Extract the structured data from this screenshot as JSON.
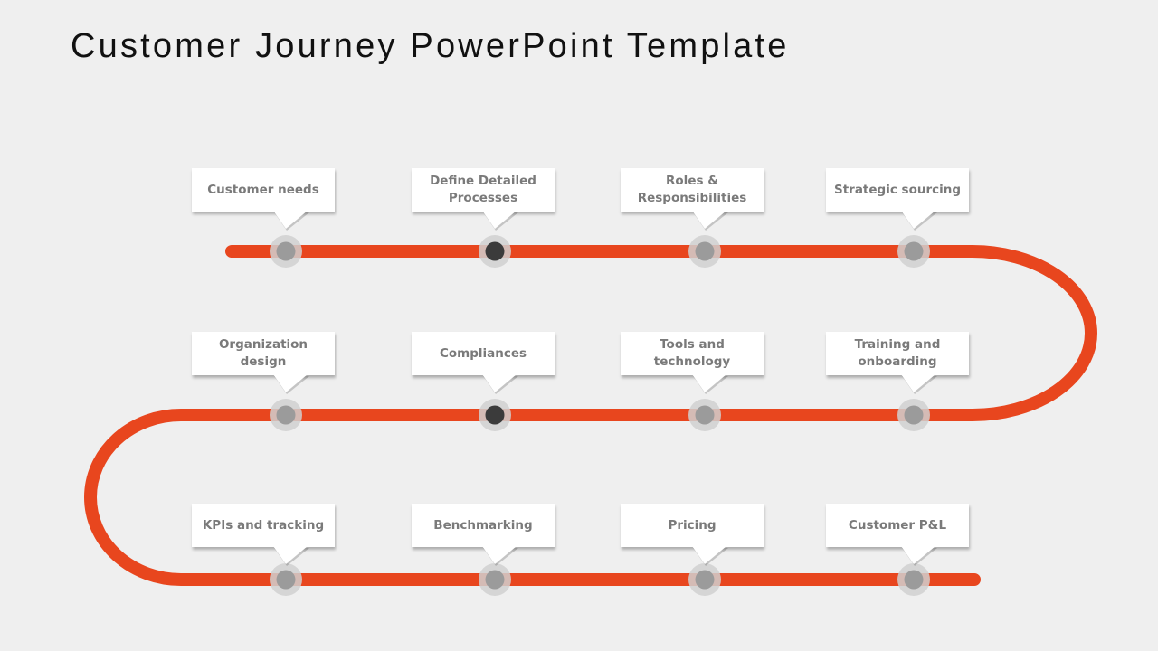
{
  "title": "Customer Journey PowerPoint Template",
  "colors": {
    "path": "#E8461E",
    "background": "#EFEFEF",
    "node_inner": "#9B9B9B",
    "node_active": "#3B3B3B",
    "node_halo": "#D0D0D0",
    "label_text": "#7A7A7A"
  },
  "rows": [
    {
      "steps": [
        {
          "label": "Customer needs",
          "active": false
        },
        {
          "label": "Define Detailed Processes",
          "active": true
        },
        {
          "label": "Roles & Responsibilities",
          "active": false
        },
        {
          "label": "Strategic sourcing",
          "active": false
        }
      ]
    },
    {
      "steps": [
        {
          "label": "Organization design",
          "active": false
        },
        {
          "label": "Compliances",
          "active": true
        },
        {
          "label": "Tools and technology",
          "active": false
        },
        {
          "label": "Training and onboarding",
          "active": false
        }
      ]
    },
    {
      "steps": [
        {
          "label": "KPIs and tracking",
          "active": false
        },
        {
          "label": "Benchmarking",
          "active": false
        },
        {
          "label": "Pricing",
          "active": false
        },
        {
          "label": "Customer P&L",
          "active": false
        }
      ]
    }
  ]
}
